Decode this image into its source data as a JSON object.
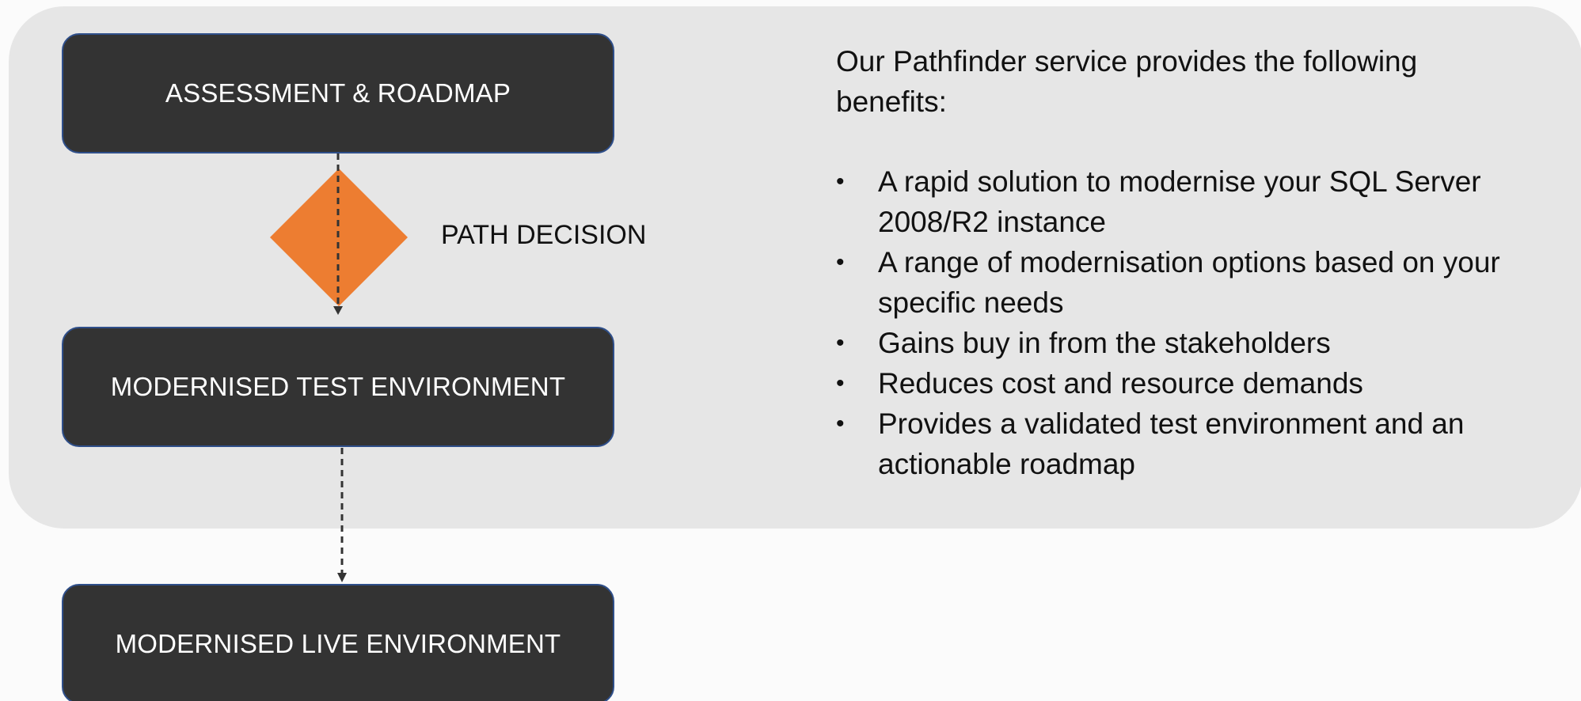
{
  "diagram": {
    "steps": [
      {
        "label": "ASSESSMENT & ROADMAP"
      },
      {
        "label": "MODERNISED TEST ENVIRONMENT"
      },
      {
        "label": "MODERNISED LIVE ENVIRONMENT"
      }
    ],
    "decision": {
      "label": "PATH DECISION",
      "color": "#ED7D31"
    },
    "colors": {
      "panel": "#E6E6E6",
      "step_box": "#333333",
      "step_border": "#2F4F8A",
      "step_text": "#FFFFFF",
      "connector": "#333333"
    }
  },
  "benefits": {
    "intro": "Our Pathfinder service provides the following benefits:",
    "bullet_symbol": "•",
    "items": [
      "A rapid solution to modernise your SQL Server 2008/R2 instance",
      "A range of modernisation options based on your specific needs",
      "Gains buy in from the stakeholders",
      "Reduces cost and resource demands",
      "Provides a validated test environment and an actionable roadmap"
    ]
  }
}
